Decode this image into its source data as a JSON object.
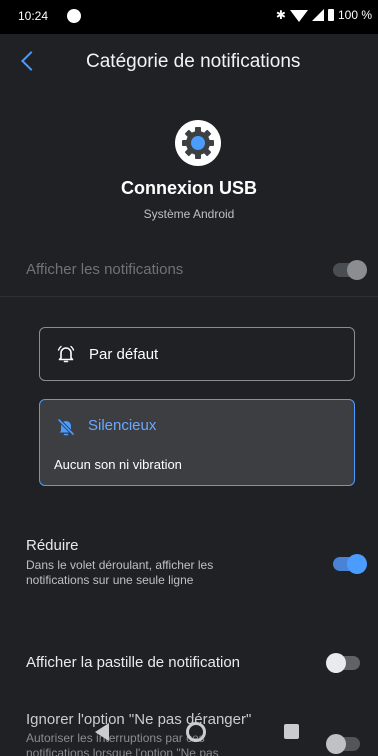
{
  "status_bar": {
    "time": "10:24",
    "battery": "100 %"
  },
  "app_bar": {
    "title": "Catégorie de notifications"
  },
  "app": {
    "name": "Connexion USB",
    "subtitle": "Système Android"
  },
  "show_notifications": {
    "label": "Afficher les notifications",
    "enabled": true
  },
  "importance": {
    "default_label": "Par défaut",
    "silent_label": "Silencieux",
    "silent_desc": "Aucun son ni vibration",
    "selected": "silent"
  },
  "minimize": {
    "label": "Réduire",
    "desc_line1": "Dans le volet déroulant, afficher les",
    "desc_line2": "notifications sur une seule ligne",
    "enabled": true
  },
  "badge": {
    "label": "Afficher la pastille de notification",
    "enabled": false
  },
  "dnd": {
    "label": "Ignorer l'option \"Ne pas déranger\"",
    "desc_line1": "Autoriser les interruptions par ces",
    "desc_line2": "notifications lorsque l'option \"Ne pas",
    "enabled": false
  },
  "colors": {
    "accent": "#4a9cff",
    "background": "#1f2124"
  }
}
